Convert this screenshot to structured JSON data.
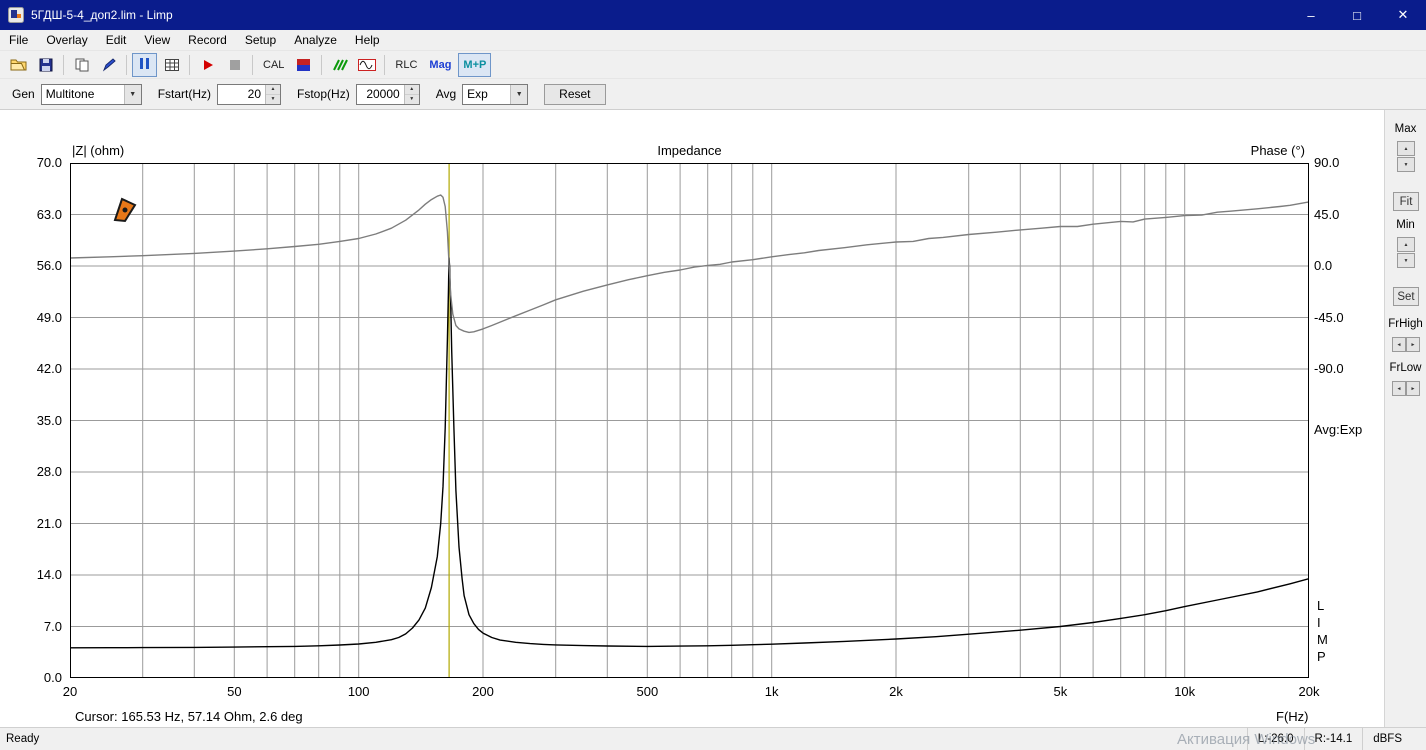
{
  "window": {
    "title": "5ГДШ-5-4_доп2.lim - Limp",
    "controls": {
      "minimize": "–",
      "maximize": "□",
      "close": "✕"
    }
  },
  "menu": {
    "items": [
      "File",
      "Overlay",
      "Edit",
      "View",
      "Record",
      "Setup",
      "Analyze",
      "Help"
    ]
  },
  "toolbar": {
    "cal_label": "CAL",
    "rlc_label": "RLC",
    "mag_label": "Mag",
    "mp_label": "M+P"
  },
  "genbar": {
    "gen_label": "Gen",
    "gen_value": "Multitone",
    "fstart_label": "Fstart(Hz)",
    "fstart_value": "20",
    "fstop_label": "Fstop(Hz)",
    "fstop_value": "20000",
    "avg_label": "Avg",
    "avg_value": "Exp",
    "reset_label": "Reset"
  },
  "side_panel": {
    "max_label": "Max",
    "fit_label": "Fit",
    "min_label": "Min",
    "set_label": "Set",
    "frhigh_label": "FrHigh",
    "frlow_label": "FrLow"
  },
  "icons": {
    "up": "▲",
    "down": "▼",
    "left": "◄",
    "right": "►",
    "dropdown": "▼"
  },
  "chart_overlay": {
    "avg_text": "Avg:Exp",
    "limp_vertical": "L\nI\nM\nP",
    "cursor_text": "Cursor: 165.53 Hz, 57.14 Ohm, 2.6 deg"
  },
  "status_bar": {
    "ready": "Ready",
    "left_level": "L:-26.0",
    "right_level": "R:-14.1",
    "unit": "dBFS",
    "watermark": "Активация Windows"
  },
  "chart_data": {
    "type": "line",
    "title": "Impedance",
    "x_axis": {
      "label": "F(Hz)",
      "scale": "log",
      "min": 20,
      "max": 20000,
      "major_ticks": [
        20,
        50,
        100,
        200,
        500,
        1000,
        2000,
        5000,
        10000,
        20000
      ],
      "tick_labels": [
        "20",
        "50",
        "100",
        "200",
        "500",
        "1k",
        "2k",
        "5k",
        "10k",
        "20k"
      ],
      "minor_ticks": [
        30,
        40,
        60,
        70,
        80,
        90,
        300,
        400,
        600,
        700,
        800,
        900,
        3000,
        4000,
        6000,
        7000,
        8000,
        9000
      ]
    },
    "y_left": {
      "label": "|Z| (ohm)",
      "min": 0,
      "max": 70,
      "tick_step": 7,
      "tick_labels": [
        "70.0",
        "63.0",
        "56.0",
        "49.0",
        "42.0",
        "35.0",
        "28.0",
        "21.0",
        "14.0",
        "7.0",
        "0.0"
      ]
    },
    "y_right": {
      "label": "Phase (°)",
      "tick_labels": [
        "90.0",
        "45.0",
        "0.0",
        "-45.0",
        "-90.0"
      ],
      "tick_ohm_positions": [
        70,
        63,
        56,
        49,
        42
      ],
      "deg_min": -90,
      "deg_max": 90,
      "ohm_at_zero_deg": 56,
      "ohm_span_per_90deg": 14
    },
    "grid": true,
    "cursor": {
      "freq_hz": 165.53,
      "impedance_ohm": 57.14,
      "phase_deg": 2.6,
      "line_color": "#b0a800"
    },
    "series": [
      {
        "name": "impedance_magnitude",
        "color": "#000000",
        "unit": "ohm",
        "points": [
          [
            20,
            4.1
          ],
          [
            25,
            4.12
          ],
          [
            30,
            4.13
          ],
          [
            40,
            4.16
          ],
          [
            50,
            4.2
          ],
          [
            60,
            4.25
          ],
          [
            70,
            4.3
          ],
          [
            80,
            4.38
          ],
          [
            90,
            4.48
          ],
          [
            100,
            4.62
          ],
          [
            110,
            4.85
          ],
          [
            120,
            5.2
          ],
          [
            125,
            5.5
          ],
          [
            130,
            6.0
          ],
          [
            135,
            6.8
          ],
          [
            140,
            7.9
          ],
          [
            145,
            9.5
          ],
          [
            150,
            12.3
          ],
          [
            155,
            16.5
          ],
          [
            158,
            21
          ],
          [
            160,
            26
          ],
          [
            162,
            34
          ],
          [
            164,
            46
          ],
          [
            165,
            53
          ],
          [
            165.5,
            57.1
          ],
          [
            166,
            56
          ],
          [
            167,
            51
          ],
          [
            168,
            44.5
          ],
          [
            170,
            34
          ],
          [
            172,
            25.5
          ],
          [
            175,
            17.8
          ],
          [
            178,
            13.5
          ],
          [
            180,
            11.2
          ],
          [
            185,
            8.6
          ],
          [
            190,
            7.4
          ],
          [
            195,
            6.6
          ],
          [
            200,
            6.1
          ],
          [
            210,
            5.5
          ],
          [
            220,
            5.15
          ],
          [
            240,
            4.85
          ],
          [
            260,
            4.68
          ],
          [
            280,
            4.57
          ],
          [
            300,
            4.5
          ],
          [
            350,
            4.4
          ],
          [
            400,
            4.35
          ],
          [
            500,
            4.3
          ],
          [
            600,
            4.33
          ],
          [
            700,
            4.38
          ],
          [
            800,
            4.44
          ],
          [
            900,
            4.52
          ],
          [
            1000,
            4.6
          ],
          [
            1200,
            4.76
          ],
          [
            1500,
            4.97
          ],
          [
            2000,
            5.3
          ],
          [
            2500,
            5.62
          ],
          [
            3000,
            5.95
          ],
          [
            4000,
            6.5
          ],
          [
            5000,
            7.0
          ],
          [
            6000,
            7.55
          ],
          [
            7000,
            8.1
          ],
          [
            8000,
            8.6
          ],
          [
            9000,
            9.15
          ],
          [
            10000,
            9.7
          ],
          [
            12000,
            10.6
          ],
          [
            15000,
            11.7
          ],
          [
            18000,
            12.8
          ],
          [
            20000,
            13.5
          ]
        ]
      },
      {
        "name": "phase",
        "color": "#7d7d7d",
        "unit": "deg",
        "points": [
          [
            20,
            7
          ],
          [
            25,
            8
          ],
          [
            30,
            9
          ],
          [
            40,
            11
          ],
          [
            50,
            13
          ],
          [
            60,
            15
          ],
          [
            70,
            17
          ],
          [
            80,
            19
          ],
          [
            90,
            21.5
          ],
          [
            100,
            24
          ],
          [
            110,
            28
          ],
          [
            120,
            33
          ],
          [
            130,
            40
          ],
          [
            140,
            49
          ],
          [
            145,
            54
          ],
          [
            150,
            58
          ],
          [
            155,
            61
          ],
          [
            158,
            62
          ],
          [
            160,
            60
          ],
          [
            162,
            52
          ],
          [
            164,
            30
          ],
          [
            165.5,
            2.6
          ],
          [
            167,
            -25
          ],
          [
            169,
            -42
          ],
          [
            172,
            -52
          ],
          [
            175,
            -55
          ],
          [
            180,
            -57
          ],
          [
            185,
            -58
          ],
          [
            190,
            -57.5
          ],
          [
            200,
            -55
          ],
          [
            210,
            -52
          ],
          [
            220,
            -49
          ],
          [
            240,
            -43.5
          ],
          [
            260,
            -38.5
          ],
          [
            280,
            -34
          ],
          [
            300,
            -29.5
          ],
          [
            350,
            -22
          ],
          [
            400,
            -16.5
          ],
          [
            450,
            -12
          ],
          [
            500,
            -8.5
          ],
          [
            550,
            -5.5
          ],
          [
            600,
            -3.5
          ],
          [
            650,
            -1
          ],
          [
            700,
            0.5
          ],
          [
            750,
            1.5
          ],
          [
            800,
            3.5
          ],
          [
            900,
            5.5
          ],
          [
            1000,
            8
          ],
          [
            1100,
            10
          ],
          [
            1200,
            11.5
          ],
          [
            1300,
            13.5
          ],
          [
            1500,
            16
          ],
          [
            1700,
            18.5
          ],
          [
            2000,
            21
          ],
          [
            2200,
            21.5
          ],
          [
            2400,
            24
          ],
          [
            2600,
            25
          ],
          [
            3000,
            27.5
          ],
          [
            3500,
            29.5
          ],
          [
            4000,
            31.5
          ],
          [
            4500,
            33
          ],
          [
            5000,
            34.5
          ],
          [
            5500,
            34.5
          ],
          [
            6000,
            36.5
          ],
          [
            7000,
            39
          ],
          [
            7500,
            38.5
          ],
          [
            8000,
            41
          ],
          [
            9000,
            42.5
          ],
          [
            10000,
            44
          ],
          [
            11000,
            44.5
          ],
          [
            12000,
            47
          ],
          [
            13000,
            48
          ],
          [
            15000,
            50
          ],
          [
            17000,
            52
          ],
          [
            18000,
            53
          ],
          [
            20000,
            56
          ]
        ]
      }
    ]
  }
}
